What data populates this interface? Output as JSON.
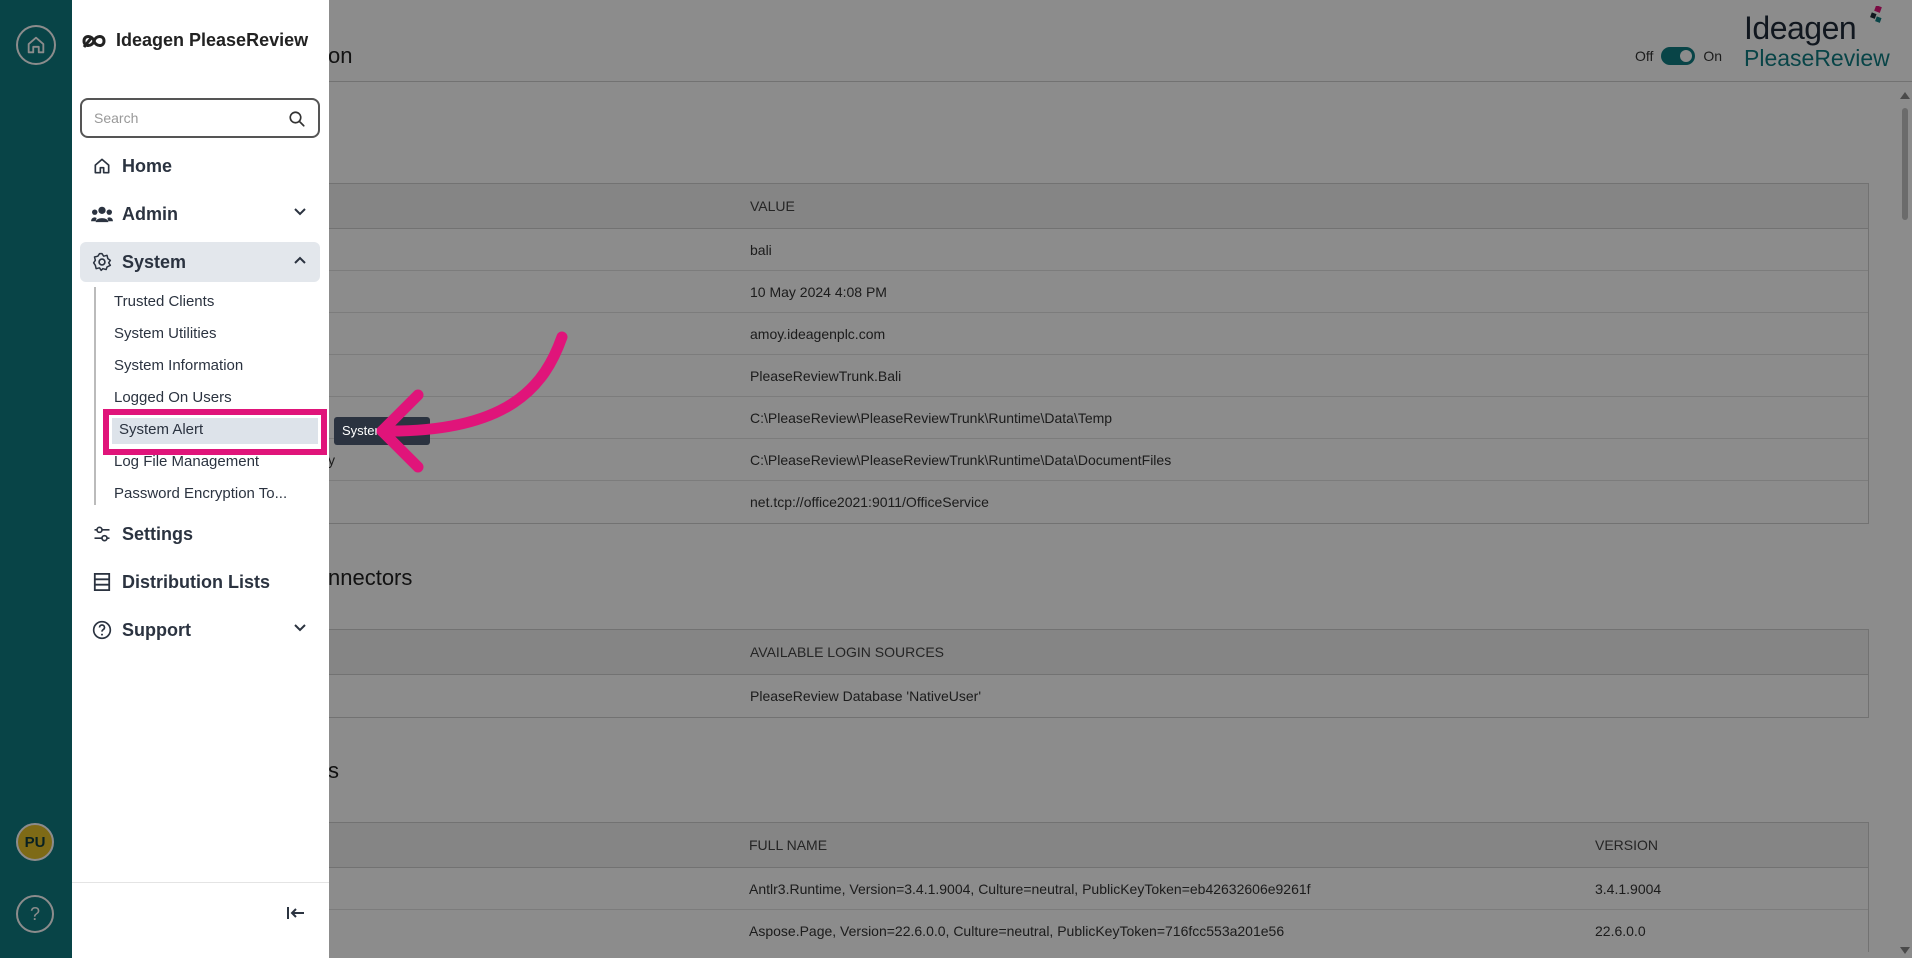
{
  "app": {
    "title": "Ideagen PleaseReview"
  },
  "header": {
    "title_suffix": "on",
    "toggle_off": "Off",
    "toggle_on": "On",
    "brand_top": "Ideagen",
    "brand_bottom": "PleaseReview"
  },
  "rail": {
    "avatar": "PU",
    "help": "?"
  },
  "nav": {
    "search_placeholder": "Search",
    "items": [
      {
        "label": "Home"
      },
      {
        "label": "Admin"
      },
      {
        "label": "System"
      },
      {
        "label": "Settings"
      },
      {
        "label": "Distribution Lists"
      },
      {
        "label": "Support"
      }
    ],
    "system_sub": [
      {
        "label": "Trusted Clients"
      },
      {
        "label": "System Utilities"
      },
      {
        "label": "System Information"
      },
      {
        "label": "Logged On Users"
      },
      {
        "label": "System Alert"
      },
      {
        "label": "Log File Management"
      },
      {
        "label": "Password Encryption To..."
      }
    ],
    "tooltip": "System Alert"
  },
  "colors": {
    "rail": "#0f7c82",
    "highlight": "#e0147a",
    "accent": "#0f7c82"
  },
  "table1": {
    "value_header": "VALUE",
    "partial_label": "y",
    "rows": [
      "bali",
      "10 May 2024 4:08 PM",
      "amoy.ideagenplc.com",
      "PleaseReviewTrunk.Bali",
      "C:\\PleaseReview\\PleaseReviewTrunk\\Runtime\\Data\\Temp",
      "C:\\PleaseReview\\PleaseReviewTrunk\\Runtime\\Data\\DocumentFiles",
      "net.tcp://office2021:9011/OfficeService"
    ]
  },
  "section2": {
    "title_partial": "nnectors",
    "header": "AVAILABLE LOGIN SOURCES",
    "rows": [
      "PleaseReview Database 'NativeUser'"
    ]
  },
  "section3": {
    "title_partial": "s",
    "header_fullname": "FULL NAME",
    "header_version": "VERSION",
    "rows": [
      {
        "fullname": "Antlr3.Runtime, Version=3.4.1.9004, Culture=neutral, PublicKeyToken=eb42632606e9261f",
        "version": "3.4.1.9004"
      },
      {
        "fullname": "Aspose.Page, Version=22.6.0.0, Culture=neutral, PublicKeyToken=716fcc553a201e56",
        "version": "22.6.0.0"
      }
    ]
  }
}
